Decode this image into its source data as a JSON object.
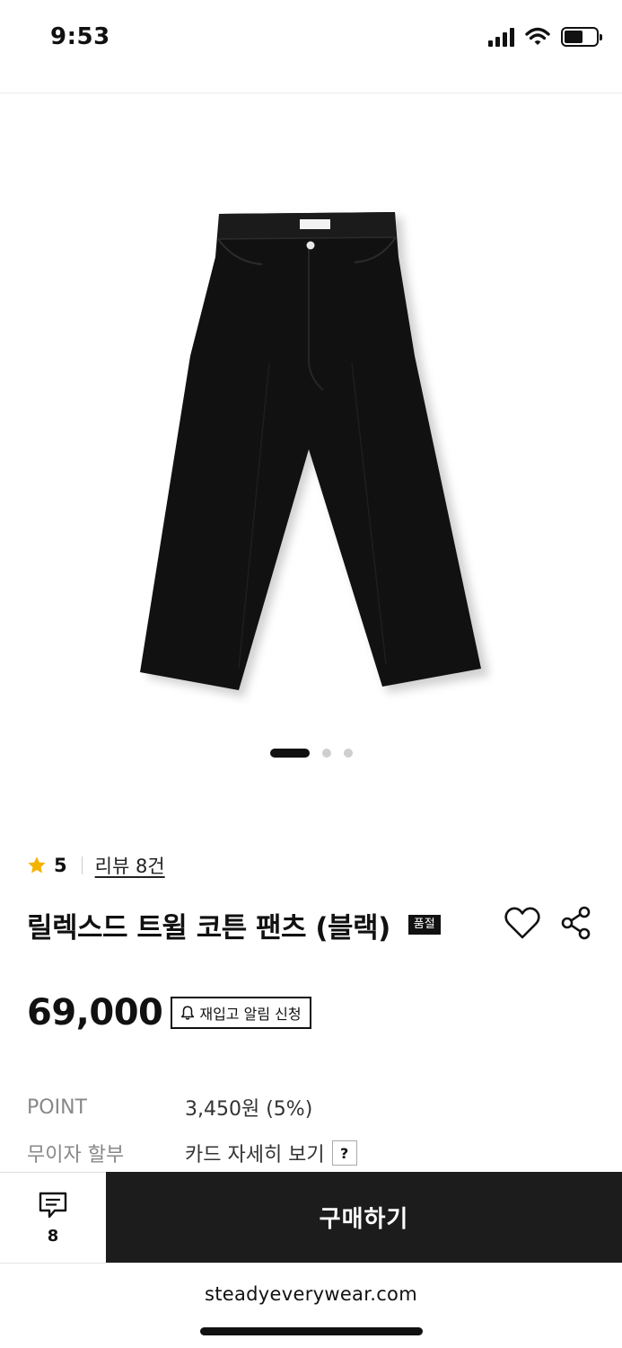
{
  "status_bar": {
    "time": "9:53",
    "icons": [
      "signal-icon",
      "wifi-icon",
      "battery-icon"
    ]
  },
  "product": {
    "image_icon": "black-pants-photo",
    "carousel": {
      "count": 3,
      "active_index": 0
    },
    "rating": {
      "score": "5",
      "review_link": "리뷰 8건"
    },
    "title": "릴렉스드 트윌 코튼 팬츠 (블랙)",
    "badge": "품절",
    "price": "69,000",
    "restock_button": "재입고 알림 신청",
    "info": [
      {
        "label": "POINT",
        "value": "3,450원 (5%)"
      },
      {
        "label": "무이자 할부",
        "value": "카드 자세히 보기",
        "help": "?"
      }
    ]
  },
  "action_bar": {
    "comment_count": "8",
    "buy_label": "구매하기"
  },
  "browser": {
    "url": "steadyeverywear.com"
  },
  "colors": {
    "star": "#f5b301",
    "buy_button": "#1c1c1c",
    "badge": "#111111"
  }
}
